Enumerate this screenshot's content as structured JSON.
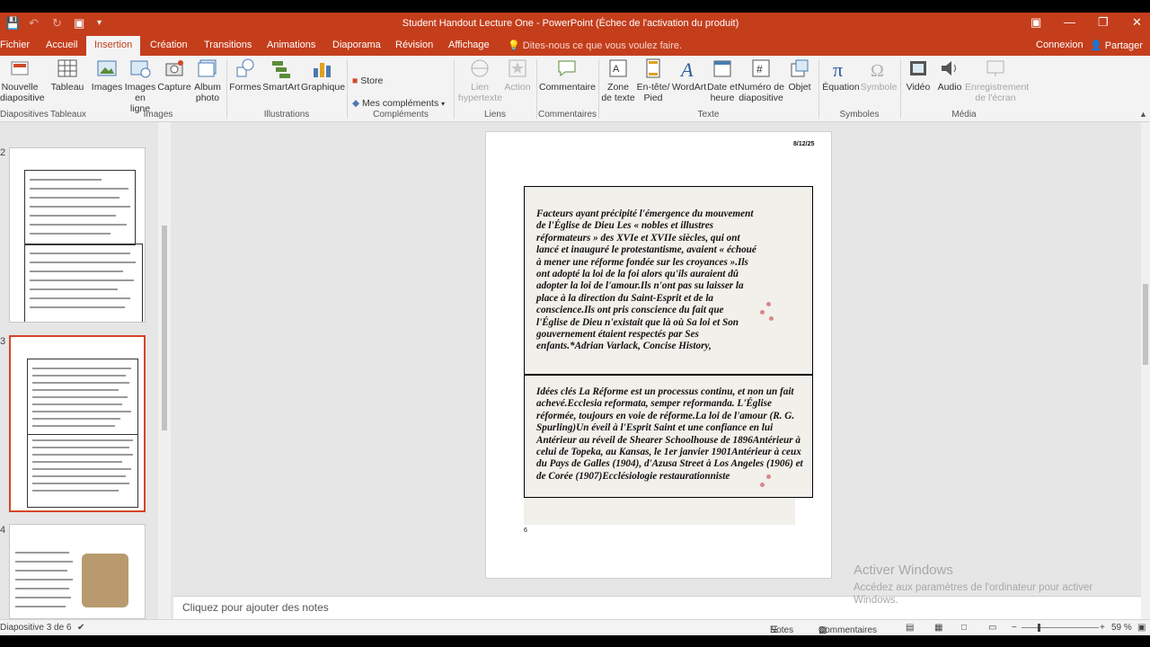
{
  "window": {
    "title": "Student Handout Lecture One - PowerPoint (Échec de l'activation du produit)"
  },
  "tabs": [
    "Fichier",
    "Accueil",
    "Insertion",
    "Création",
    "Transitions",
    "Animations",
    "Diaporama",
    "Révision",
    "Affichage"
  ],
  "active_tab": "Insertion",
  "tell_me": "Dites-nous ce que vous voulez faire.",
  "account": {
    "signin": "Connexion",
    "share": "Partager"
  },
  "ribbon": {
    "buttons": {
      "new_slide": "Nouvelle diapositive",
      "table": "Tableau",
      "images": "Images",
      "online_images": "Images en ligne",
      "capture": "Capture",
      "album": "Album photo",
      "shapes": "Formes",
      "smartart": "SmartArt",
      "graph": "Graphique",
      "store": "Store",
      "my_addins": "Mes compléments",
      "hyperlink": "Lien hypertexte",
      "action": "Action",
      "comment": "Commentaire",
      "textbox": "Zone de texte",
      "header_footer": "En-tête/ Pied",
      "wordart": "WordArt",
      "datetime": "Date et heure",
      "slide_number": "Numéro de diapositive",
      "object": "Objet",
      "equation": "Équation",
      "symbol": "Symbole",
      "video": "Vidéo",
      "audio": "Audio",
      "screen_recording": "Enregistrement de l'écran"
    },
    "groups": {
      "slides": "Diapositives",
      "tables": "Tableaux",
      "images": "Images",
      "illustrations": "Illustrations",
      "addins": "Compléments",
      "links": "Liens",
      "comments": "Commentaires",
      "text": "Texte",
      "symbols": "Symboles",
      "media": "Média"
    }
  },
  "thumbnails": [
    {
      "number": "2",
      "selected": false
    },
    {
      "number": "3",
      "selected": true
    },
    {
      "number": "4",
      "selected": false
    }
  ],
  "slide": {
    "date": "8/12/25",
    "page_number": "6",
    "text1": "Facteurs ayant précipité l'émergence du mouvement de l'Église de Dieu Les « nobles et illustres réformateurs » des XVIe et XVIIe siècles, qui ont lancé et inauguré le protestantisme, avaient « échoué à mener une réforme    fondée sur les croyances ».Ils ont adopté la loi de la foi alors qu'ils auraient dû adopter la loi de l'amour.Ils n'ont pas su laisser la place à la direction du Saint-Esprit et de la conscience.Ils ont pris conscience du fait que l'Église de Dieu n'existait que là où Sa loi et Son gouvernement étaient respectés par Ses enfants.*Adrian Varlack, Concise History,",
    "text2": "Idées clés La Réforme est un processus continu, et non un fait achevé.Ecclesia reformata, semper reformanda. L'Église réformée, toujours en voie de réforme.La loi de l'amour (R. G. Spurling)Un éveil à l'Esprit Saint et une confiance en lui Antérieur au réveil de Shearer Schoolhouse de 1896Antérieur à celui de Topeka, au Kansas, le 1er janvier 1901Antérieur à ceux du Pays de Galles (1904), d'Azusa Street à Los Angeles (1906) et de Corée (1907)Ecclésiologie restaurationniste"
  },
  "notes_placeholder": "Cliquez pour ajouter des notes",
  "status": {
    "slide_info": "Diapositive 3 de 6",
    "notes": "Notes",
    "comments": "Commentaires",
    "zoom": "59 %"
  },
  "watermark": {
    "title": "Activer Windows",
    "subtitle": "Accédez aux paramètres de l'ordinateur pour activer Windows."
  },
  "colors": {
    "accent": "#c43e1c",
    "selection": "#d24726"
  }
}
